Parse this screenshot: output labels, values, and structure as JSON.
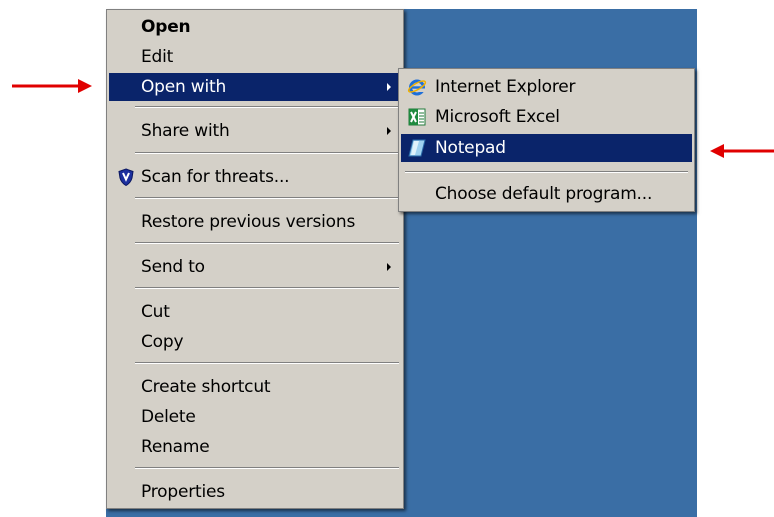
{
  "main_menu": {
    "open": "Open",
    "edit": "Edit",
    "open_with": "Open with",
    "share_with": "Share with",
    "scan": "Scan for threats...",
    "restore": "Restore previous versions",
    "send_to": "Send to",
    "cut": "Cut",
    "copy": "Copy",
    "create_shortcut": "Create shortcut",
    "delete": "Delete",
    "rename": "Rename",
    "properties": "Properties"
  },
  "open_with_menu": {
    "internet_explorer": "Internet Explorer",
    "excel": "Microsoft Excel",
    "notepad": "Notepad",
    "choose_default": "Choose default program..."
  },
  "icons": {
    "scan": "shield-icon",
    "internet_explorer": "internet-explorer-icon",
    "excel": "excel-icon",
    "notepad": "notepad-icon"
  },
  "colors": {
    "menu_background": "#d4d0c8",
    "highlight": "#0a246a",
    "desktop": "#3a6ea5",
    "annotation_arrow": "#e00000"
  }
}
